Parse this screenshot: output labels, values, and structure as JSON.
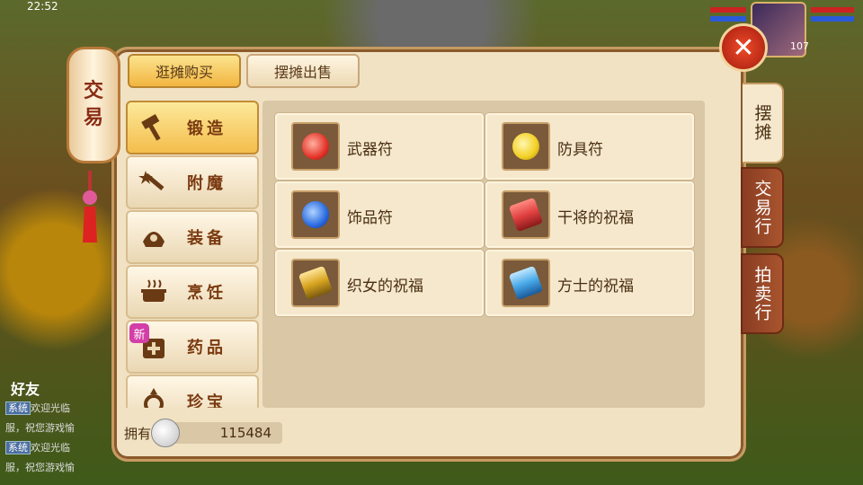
{
  "hud": {
    "time": "22:52",
    "level": "107"
  },
  "lantern": {
    "line1": "交",
    "line2": "易"
  },
  "tabs": {
    "buy": "逛摊购买",
    "sell": "摆摊出售"
  },
  "side_tabs": [
    {
      "label": "摆摊"
    },
    {
      "label": "交易行"
    },
    {
      "label": "拍卖行"
    }
  ],
  "categories": [
    {
      "label": "锻造",
      "icon": "hammer-icon"
    },
    {
      "label": "附魔",
      "icon": "magic-wand-icon"
    },
    {
      "label": "装备",
      "icon": "helmet-icon"
    },
    {
      "label": "烹饪",
      "icon": "cooking-pot-icon"
    },
    {
      "label": "药品",
      "icon": "medicine-icon",
      "badge": "新"
    },
    {
      "label": "珍宝",
      "icon": "treasure-icon"
    }
  ],
  "items": [
    {
      "label": "武器符",
      "color": "#e4342a"
    },
    {
      "label": "防具符",
      "color": "#f2cf22"
    },
    {
      "label": "饰品符",
      "color": "#2a6ae0"
    },
    {
      "label": "干将的祝福",
      "color": "#e04040"
    },
    {
      "label": "织女的祝福",
      "color": "#d9a520"
    },
    {
      "label": "方士的祝福",
      "color": "#48a8e8"
    }
  ],
  "money": {
    "label": "拥有",
    "value": "115484"
  },
  "chat": {
    "friends_label": "好友",
    "lines": [
      {
        "tag": "系统",
        "text": "欢迎光临"
      },
      {
        "tag": "",
        "text": "服，祝您游戏愉"
      },
      {
        "tag": "系统",
        "text": "欢迎光临"
      },
      {
        "tag": "",
        "text": "服，祝您游戏愉"
      }
    ]
  },
  "close_glyph": "✕"
}
